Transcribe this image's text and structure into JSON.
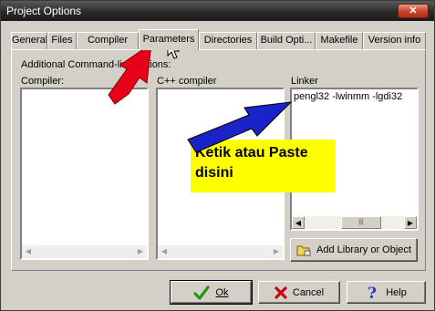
{
  "window": {
    "title": "Project Options",
    "close_glyph": "✕"
  },
  "tabs": [
    {
      "label": "General"
    },
    {
      "label": "Files"
    },
    {
      "label": "Compiler"
    },
    {
      "label": "Parameters"
    },
    {
      "label": "Directories"
    },
    {
      "label": "Build Opti..."
    },
    {
      "label": "Makefile"
    },
    {
      "label": "Version info"
    }
  ],
  "panel": {
    "group_label": "Additional Command-line options:",
    "compiler_label": "Compiler:",
    "cpp_label": "C++ compiler",
    "linker_label": "Linker",
    "linker_value": "pengl32 -lwinmm -lgdi32"
  },
  "buttons": {
    "add_library": "Add Library or Object",
    "ok": "Ok",
    "cancel": "Cancel",
    "help": "Help"
  },
  "annotation": {
    "text": "Ketik atau Paste disini"
  },
  "colors": {
    "arrow_red": "#e8001a",
    "arrow_blue": "#1a23c8",
    "callout_yellow": "#ffff00"
  }
}
